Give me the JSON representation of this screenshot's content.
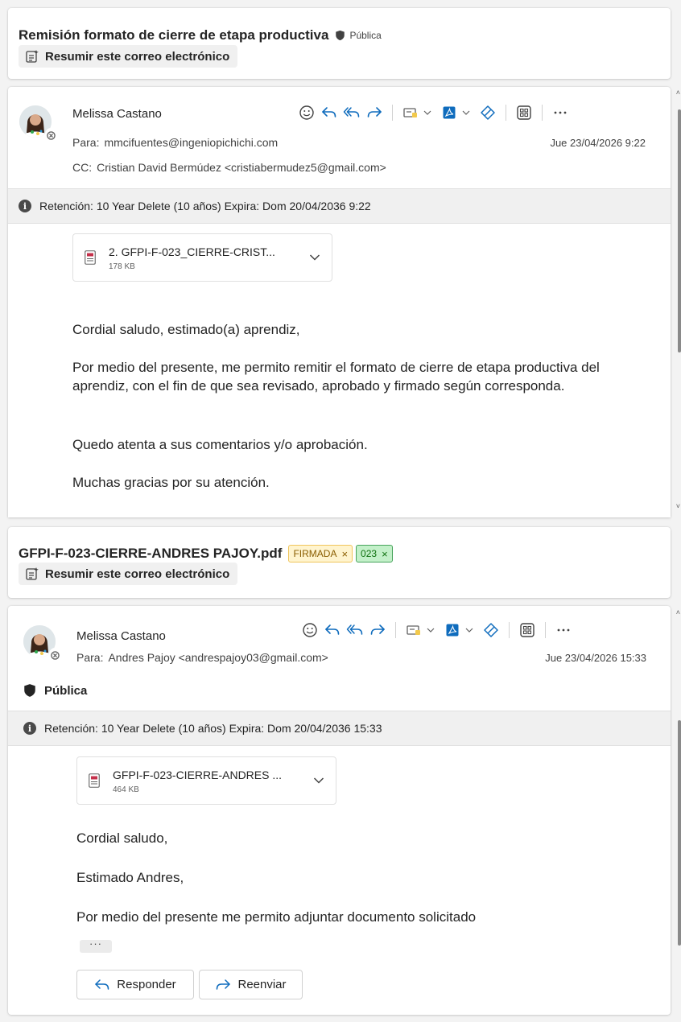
{
  "thread1": {
    "subject": "Remisión formato de cierre de etapa productiva",
    "sensitivity": "Pública",
    "summarize_label": "Resumir este correo electrónico",
    "message": {
      "sender": "Melissa Castano",
      "to_label": "Para:",
      "to": "mmcifuentes@ingeniopichichi.com",
      "cc_label": "CC:",
      "cc": "Cristian David Bermúdez <cristiabermudez5@gmail.com>",
      "datetime": "Jue 23/04/2026 9:22",
      "retention": "Retención: 10 Year Delete (10 años) Expira: Dom 20/04/2036 9:22",
      "attachment": {
        "name": "2. GFPI-F-023_CIERRE-CRIST...",
        "size": "178 KB"
      },
      "body": [
        "Cordial saludo, estimado(a) aprendiz,",
        "Por medio del presente, me permito remitir el formato de cierre de etapa productiva del aprendiz, con el fin de que sea revisado, aprobado y firmado según corresponda.",
        "Quedo atenta a sus comentarios y/o aprobación.",
        "Muchas gracias por su atención."
      ]
    }
  },
  "thread2": {
    "subject": "GFPI-F-023-CIERRE-ANDRES PAJOY.pdf",
    "tags": [
      {
        "label": "FIRMADA",
        "color": "#fff4ce"
      },
      {
        "label": "023",
        "color": "#c3f0c9"
      }
    ],
    "summarize_label": "Resumir este correo electrónico",
    "message": {
      "sender": "Melissa Castano",
      "to_label": "Para:",
      "to": "Andres Pajoy <andrespajoy03@gmail.com>",
      "datetime": "Jue 23/04/2026 15:33",
      "sensitivity": "Pública",
      "retention": "Retención: 10 Year Delete (10 años) Expira: Dom 20/04/2036 15:33",
      "attachment": {
        "name": "GFPI-F-023-CIERRE-ANDRES ...",
        "size": "464 KB"
      },
      "body": [
        "Cordial saludo,",
        "Estimado Andres,",
        "Por medio del presente me permito adjuntar documento solicitado"
      ],
      "more": "···",
      "reply_label": "Responder",
      "forward_label": "Reenviar"
    }
  },
  "icons": {
    "toolbar": [
      "emoji-icon",
      "reply-icon",
      "reply-all-icon",
      "forward-icon",
      "move-icon",
      "pdf-icon",
      "loop-icon",
      "apps-icon",
      "more-icon"
    ],
    "accent": "#0f6cbd",
    "pdf": "#c4314b"
  }
}
